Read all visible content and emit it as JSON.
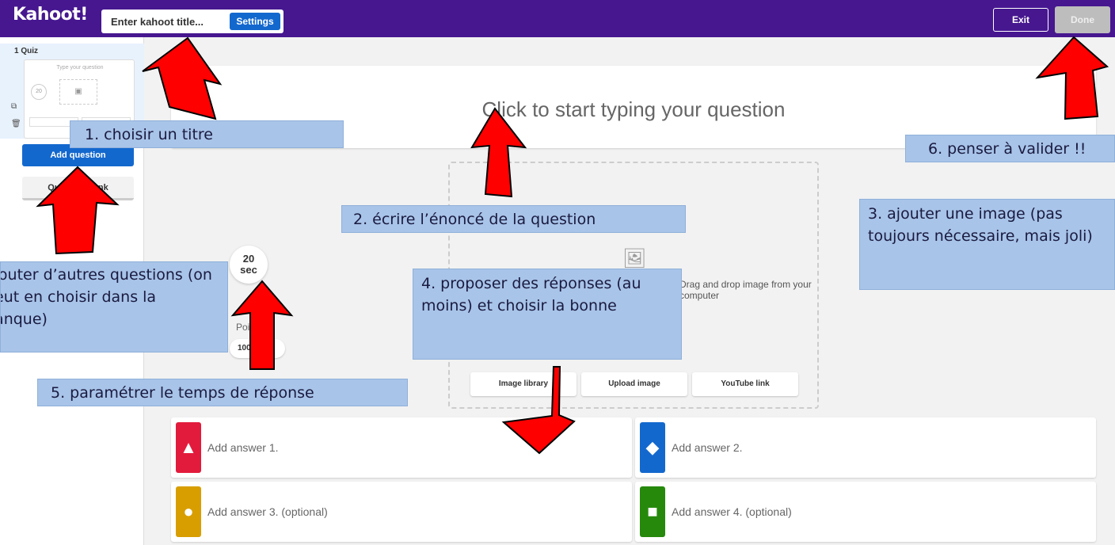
{
  "topbar": {
    "logo": "Kahoot!",
    "title_placeholder": "Enter kahoot title...",
    "settings_label": "Settings",
    "exit_label": "Exit",
    "done_label": "Done"
  },
  "sidebar": {
    "slide_label": "1  Quiz",
    "thumb_question": "Type your question",
    "thumb_time": "20",
    "add_question_label": "Add question",
    "question_bank_label": "Question bank"
  },
  "editor": {
    "question_placeholder": "Click to start typing your question",
    "media_text": "Drag and drop image from your computer",
    "media_buttons": [
      "Image library",
      "Upload image",
      "YouTube link"
    ],
    "timer_value": "20",
    "timer_unit": "sec",
    "points_label": "Points",
    "points_value": "1000"
  },
  "answers": [
    {
      "label": "Add answer 1.",
      "color": "#e21b3c",
      "shape": "triangle"
    },
    {
      "label": "Add answer 2.",
      "color": "#1368ce",
      "shape": "diamond"
    },
    {
      "label": "Add answer 3. (optional)",
      "color": "#d89e00",
      "shape": "circle"
    },
    {
      "label": "Add answer 4. (optional)",
      "color": "#26890c",
      "shape": "square"
    }
  ],
  "annotations": {
    "n1": "1. choisir un titre",
    "n2": "2. écrire l’énoncé de la question",
    "n3": "3. ajouter une image (pas toujours nécessaire, mais joli)",
    "n4": "4. proposer des réponses (au moins) et choisir la bonne",
    "n5": "5. paramétrer le temps de réponse",
    "n6": "6. penser à valider !!",
    "n7": "ajouter d’autres questions (on peut en choisir dans la banque)"
  },
  "colors": {
    "topbar": "#46178f",
    "accent_blue": "#1368ce",
    "arrow_red": "#ff0000",
    "note_bg": "#a8c4e8"
  }
}
